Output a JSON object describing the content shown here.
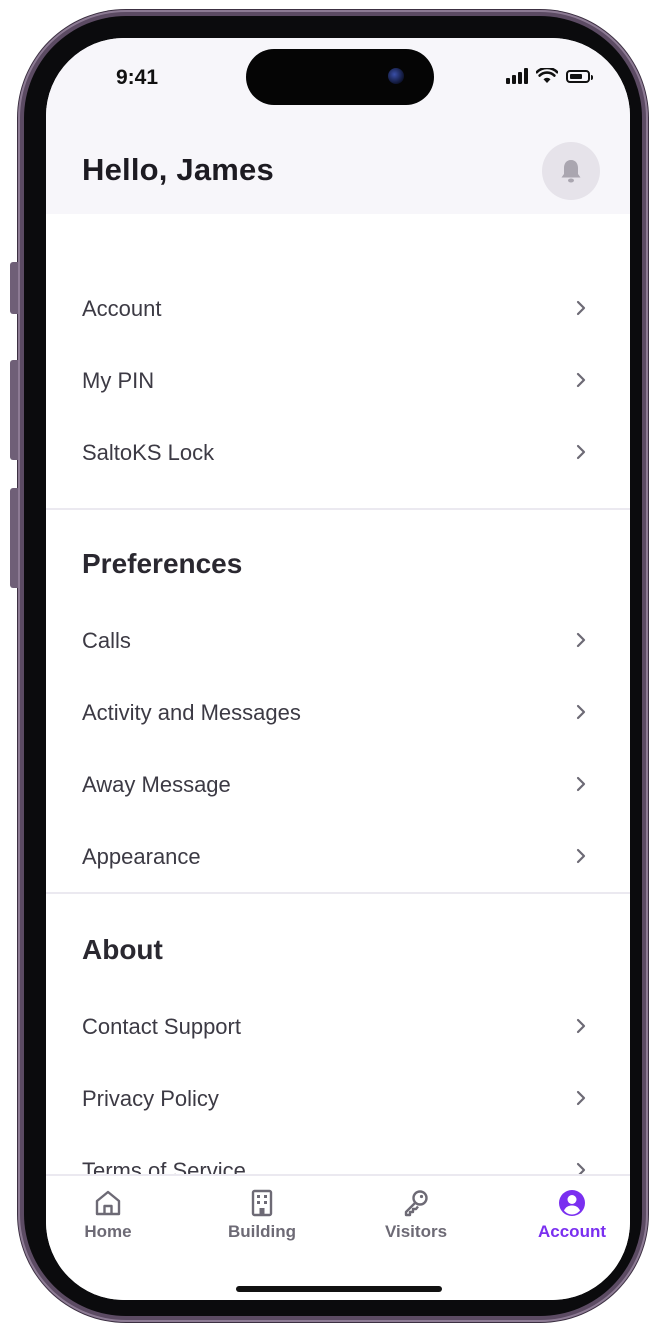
{
  "status_bar": {
    "time": "9:41"
  },
  "header": {
    "greeting": "Hello, James",
    "bell_icon": "bell-icon"
  },
  "account_items": [
    {
      "label": "Account"
    },
    {
      "label": "My PIN"
    },
    {
      "label": "SaltoKS Lock"
    }
  ],
  "preferences": {
    "title": "Preferences",
    "items": [
      {
        "label": "Calls"
      },
      {
        "label": "Activity and Messages"
      },
      {
        "label": "Away Message"
      },
      {
        "label": "Appearance"
      }
    ]
  },
  "about": {
    "title": "About",
    "items": [
      {
        "label": "Contact Support"
      },
      {
        "label": "Privacy Policy"
      },
      {
        "label": "Terms of Service"
      }
    ]
  },
  "tabbar": {
    "tabs": [
      {
        "label": "Home",
        "icon": "home-icon",
        "active": false
      },
      {
        "label": "Building",
        "icon": "building-icon",
        "active": false
      },
      {
        "label": "Visitors",
        "icon": "key-icon",
        "active": false
      },
      {
        "label": "Account",
        "icon": "user-circle-icon",
        "active": true
      }
    ]
  },
  "colors": {
    "accent": "#7a2ff0",
    "text": "#3c3a44",
    "header_bg": "#f7f6fa",
    "divider": "#ebe9f0"
  }
}
